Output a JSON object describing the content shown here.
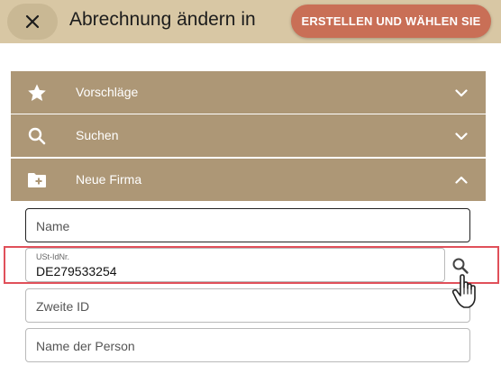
{
  "header": {
    "title": "Abrechnung ändern in",
    "create_button": "ERSTELLEN UND WÄHLEN SIE"
  },
  "accordion": [
    {
      "label": "Vorschläge",
      "icon": "star-icon",
      "expanded": false
    },
    {
      "label": "Suchen",
      "icon": "search-icon",
      "expanded": false
    },
    {
      "label": "Neue Firma",
      "icon": "folder-add-icon",
      "expanded": true
    }
  ],
  "form": {
    "name_placeholder": "Name",
    "vat_label": "USt-IdNr.",
    "vat_value": "DE279533254",
    "second_id_placeholder": "Zweite ID",
    "person_name_placeholder": "Name der Person"
  },
  "colors": {
    "header_bg": "#d8c7a4",
    "accordion_bg": "#ad9776",
    "primary_button": "#c96f56",
    "highlight": "#e0505a"
  }
}
